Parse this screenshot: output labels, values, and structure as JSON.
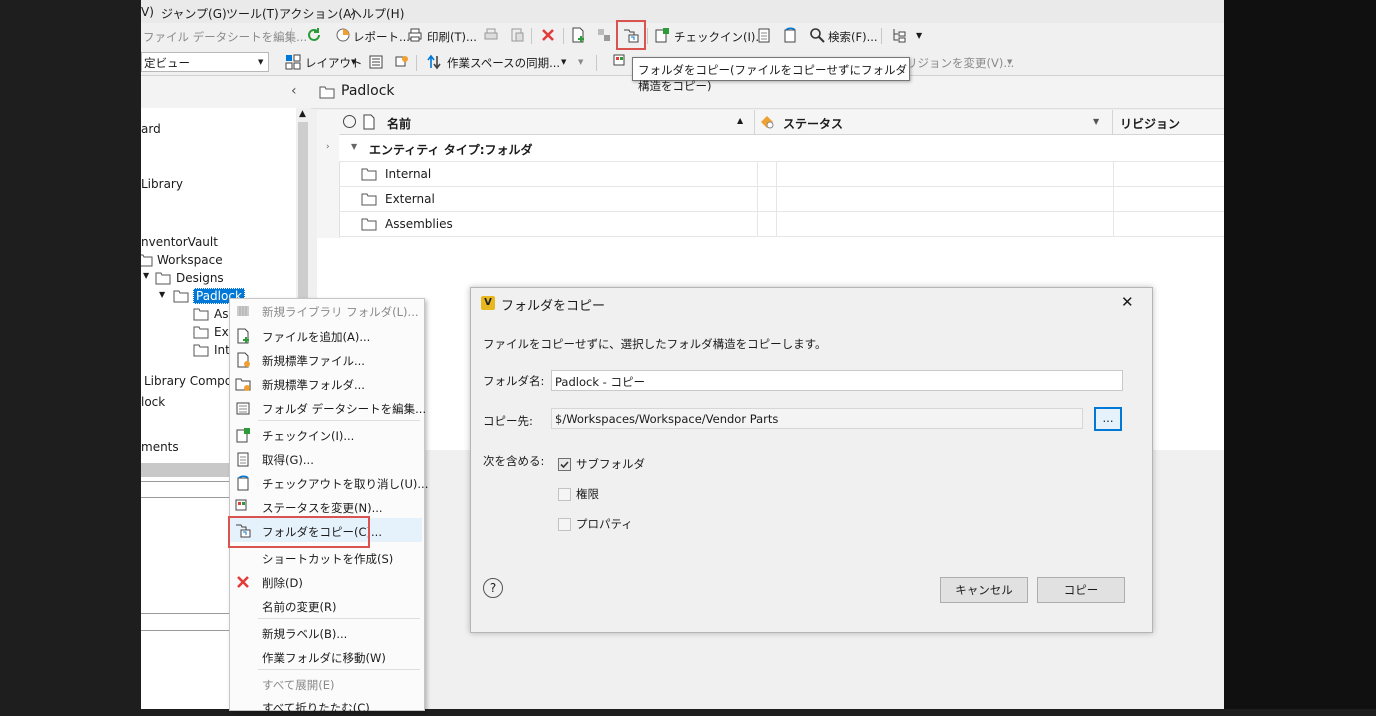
{
  "menu": [
    "V)",
    "ジャンプ(G)",
    "ツール(T)",
    "アクション(A)",
    "ヘルプ(H)"
  ],
  "toolbar1": {
    "edit_datasheet": "ファイル データシートを編集...",
    "report": "レポート...",
    "print": "印刷(T)...",
    "checkin": "チェックイン(I)...",
    "search": "検索(F)..."
  },
  "toolbar2": {
    "view_combo": "定ビュー",
    "layout": "レイアウト",
    "sync": "作業スペースの同期...",
    "change_revision": "リジョンを変更(V)..."
  },
  "tooltip": "フォルダをコピー(ファイルをコピーせずにフォルダ構造をコピー)",
  "breadcrumb": "Padlock",
  "tree": {
    "items": [
      "ard",
      "Library",
      "nventorVault",
      "Workspace",
      "Designs",
      "Padlock",
      "As",
      "Ext",
      "Int",
      "Library Compon",
      "lock",
      "ments"
    ]
  },
  "grid": {
    "col_name": "名前",
    "col_status": "ステータス",
    "col_revision": "リビジョン",
    "group_label": "エンティティ タイプ:フォルダ",
    "rows": [
      "Internal",
      "External",
      "Assemblies"
    ]
  },
  "context_menu": {
    "items": [
      "新規ライブラリ フォルダ(L)...",
      "ファイルを追加(A)...",
      "新規標準ファイル...",
      "新規標準フォルダ...",
      "フォルダ データシートを編集...",
      "チェックイン(I)...",
      "取得(G)...",
      "チェックアウトを取り消し(U)...",
      "ステータスを変更(N)...",
      "フォルダをコピー(C)...",
      "ショートカットを作成(S)",
      "削除(D)",
      "名前の変更(R)",
      "新規ラベル(B)...",
      "作業フォルダに移動(W)",
      "すべて展開(E)",
      "すべて折りたたむ(C)"
    ]
  },
  "dialog": {
    "title": "フォルダをコピー",
    "description": "ファイルをコピーせずに、選択したフォルダ構造をコピーします。",
    "folder_name_label": "フォルダ名:",
    "folder_name_value": "Padlock - コピー",
    "dest_label": "コピー先:",
    "dest_value": "$/Workspaces/Workspace/Vendor Parts",
    "browse_label": "...",
    "include_label": "次を含める:",
    "opt_subfolder": "サブフォルダ",
    "opt_permissions": "権限",
    "opt_properties": "プロパティ",
    "cancel_label": "キャンセル",
    "copy_label": "コピー",
    "help_label": "?"
  },
  "colors": {
    "accent": "#0078d7",
    "highlight": "#d9534f",
    "delete": "#e23b3b"
  }
}
